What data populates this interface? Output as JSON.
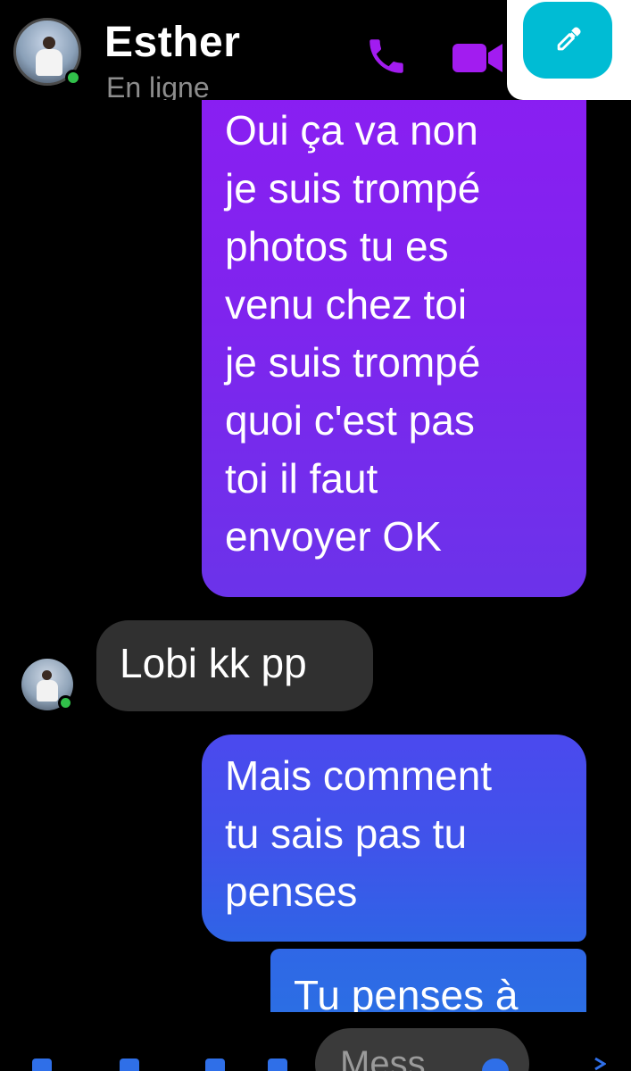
{
  "header": {
    "contact_name": "Esther",
    "status": "En ligne",
    "icons": {
      "call": "phone-icon",
      "video": "video-camera-icon",
      "fab": "eyedropper-icon"
    }
  },
  "messages": [
    {
      "sender": "me",
      "text": "Oui ça va non\nje suis trompé\nphotos tu es\nvenu chez toi\nje suis trompé\nquoi c'est pas\ntoi il faut\nenvoyer OK"
    },
    {
      "sender": "Esther",
      "text": "Lobi kk pp"
    },
    {
      "sender": "me",
      "text": "Mais comment\ntu sais pas tu\npenses"
    },
    {
      "sender": "me",
      "text": "Tu penses à"
    }
  ],
  "composer": {
    "input_value": "Mess"
  },
  "colors": {
    "accent_purple": "#8a1ef2",
    "accent_blue": "#2f64e6",
    "incoming_bubble": "#303030",
    "online": "#31c04a",
    "fab": "#00bcd4"
  }
}
